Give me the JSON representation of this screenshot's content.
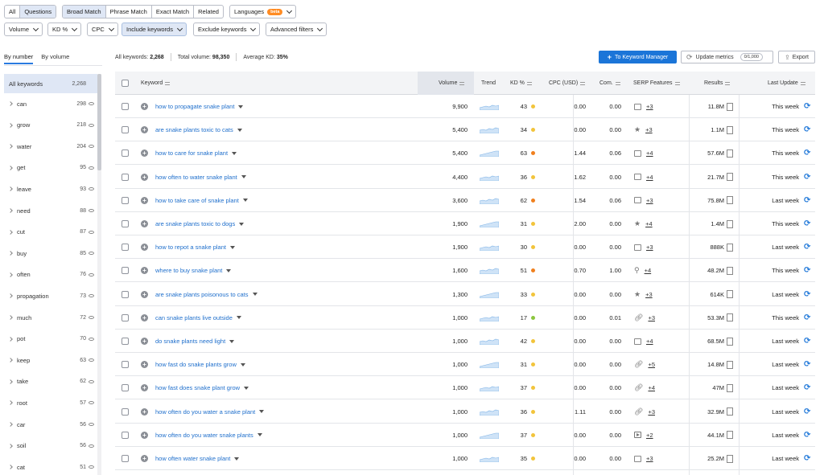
{
  "filters_row1": {
    "tabs": [
      "All",
      "Questions"
    ],
    "active_tab": "Questions",
    "match": [
      "Broad Match",
      "Phrase Match",
      "Exact Match",
      "Related"
    ],
    "active_match": "Broad Match",
    "languages": "Languages",
    "beta": "beta"
  },
  "filters_row2": {
    "volume": "Volume",
    "kd": "KD %",
    "cpc": "CPC",
    "include": "Include keywords",
    "exclude": "Exclude keywords",
    "advanced": "Advanced filters"
  },
  "sidebar": {
    "tab_number": "By number",
    "tab_volume": "By volume",
    "all_label": "All keywords",
    "all_count": "2,268",
    "items": [
      {
        "label": "can",
        "count": "298"
      },
      {
        "label": "grow",
        "count": "218"
      },
      {
        "label": "water",
        "count": "204"
      },
      {
        "label": "get",
        "count": "95"
      },
      {
        "label": "leave",
        "count": "93"
      },
      {
        "label": "need",
        "count": "88"
      },
      {
        "label": "cut",
        "count": "87"
      },
      {
        "label": "buy",
        "count": "85"
      },
      {
        "label": "often",
        "count": "76"
      },
      {
        "label": "propagation",
        "count": "73"
      },
      {
        "label": "much",
        "count": "72"
      },
      {
        "label": "pot",
        "count": "70"
      },
      {
        "label": "keep",
        "count": "63"
      },
      {
        "label": "take",
        "count": "62"
      },
      {
        "label": "root",
        "count": "57"
      },
      {
        "label": "car",
        "count": "56"
      },
      {
        "label": "soil",
        "count": "56"
      },
      {
        "label": "cat",
        "count": "51"
      }
    ]
  },
  "summary": {
    "all_keywords_label": "All keywords:",
    "all_keywords": "2,268",
    "total_volume_label": "Total volume:",
    "total_volume": "98,350",
    "avg_kd_label": "Average KD:",
    "avg_kd": "35%"
  },
  "actions": {
    "to_manager": "To Keyword Manager",
    "update": "Update metrics",
    "update_count": "0/1,000",
    "export": "Export"
  },
  "columns": {
    "keyword": "Keyword",
    "volume": "Volume",
    "trend": "Trend",
    "kd": "KD %",
    "cpc": "CPC (USD)",
    "com": "Com.",
    "serp": "SERP Features",
    "results": "Results",
    "last_update": "Last Update"
  },
  "colors": {
    "kd_yellow": "#f2c43b",
    "kd_orange": "#f0801e",
    "kd_green": "#8cc63f"
  },
  "rows": [
    {
      "keyword": "how to propagate snake plant",
      "volume": "9,900",
      "kd": "43",
      "kd_color": "yellow",
      "cpc": "0.00",
      "com": "0.00",
      "serp_icon": "image-icon",
      "serp_more": "+3",
      "results": "11.8M",
      "update": "This week"
    },
    {
      "keyword": "are snake plants toxic to cats",
      "volume": "5,400",
      "kd": "34",
      "kd_color": "yellow",
      "cpc": "0.00",
      "com": "0.00",
      "serp_icon": "star-icon",
      "serp_more": "+3",
      "results": "1.1M",
      "update": "This week"
    },
    {
      "keyword": "how to care for snake plant",
      "volume": "5,400",
      "kd": "63",
      "kd_color": "orange",
      "cpc": "1.44",
      "com": "0.06",
      "serp_icon": "image-icon",
      "serp_more": "+4",
      "results": "57.6M",
      "update": "This week"
    },
    {
      "keyword": "how often to water snake plant",
      "volume": "4,400",
      "kd": "36",
      "kd_color": "yellow",
      "cpc": "1.62",
      "com": "0.00",
      "serp_icon": "image-icon",
      "serp_more": "+4",
      "results": "21.7M",
      "update": "This week"
    },
    {
      "keyword": "how to take care of snake plant",
      "volume": "3,600",
      "kd": "62",
      "kd_color": "orange",
      "cpc": "1.54",
      "com": "0.06",
      "serp_icon": "image-icon",
      "serp_more": "+3",
      "results": "75.8M",
      "update": "Last week"
    },
    {
      "keyword": "are snake plants toxic to dogs",
      "volume": "1,900",
      "kd": "31",
      "kd_color": "yellow",
      "cpc": "2.00",
      "com": "0.00",
      "serp_icon": "star-icon",
      "serp_more": "+4",
      "results": "1.4M",
      "update": "This week"
    },
    {
      "keyword": "how to repot a snake plant",
      "volume": "1,900",
      "kd": "30",
      "kd_color": "yellow",
      "cpc": "0.00",
      "com": "0.00",
      "serp_icon": "image-icon",
      "serp_more": "+3",
      "results": "888K",
      "update": "Last week"
    },
    {
      "keyword": "where to buy snake plant",
      "volume": "1,600",
      "kd": "51",
      "kd_color": "orange",
      "cpc": "0.70",
      "com": "1.00",
      "serp_icon": "pin-icon",
      "serp_more": "+4",
      "results": "48.2M",
      "update": "This week"
    },
    {
      "keyword": "are snake plants poisonous to cats",
      "volume": "1,300",
      "kd": "33",
      "kd_color": "yellow",
      "cpc": "0.00",
      "com": "0.00",
      "serp_icon": "star-icon",
      "serp_more": "+3",
      "results": "614K",
      "update": "Last week"
    },
    {
      "keyword": "can snake plants live outside",
      "volume": "1,000",
      "kd": "17",
      "kd_color": "green",
      "cpc": "0.00",
      "com": "0.01",
      "serp_icon": "link-icon",
      "serp_more": "+3",
      "results": "53.3M",
      "update": "This week"
    },
    {
      "keyword": "do snake plants need light",
      "volume": "1,000",
      "kd": "42",
      "kd_color": "yellow",
      "cpc": "0.00",
      "com": "0.00",
      "serp_icon": "image-icon",
      "serp_more": "+4",
      "results": "68.5M",
      "update": "Last week"
    },
    {
      "keyword": "how fast do snake plants grow",
      "volume": "1,000",
      "kd": "31",
      "kd_color": "yellow",
      "cpc": "0.00",
      "com": "0.00",
      "serp_icon": "link-icon",
      "serp_more": "+5",
      "results": "14.8M",
      "update": "Last week"
    },
    {
      "keyword": "how fast does snake plant grow",
      "volume": "1,000",
      "kd": "37",
      "kd_color": "yellow",
      "cpc": "0.00",
      "com": "0.00",
      "serp_icon": "link-icon",
      "serp_more": "+4",
      "results": "47M",
      "update": "Last week"
    },
    {
      "keyword": "how often do you water a snake plant",
      "volume": "1,000",
      "kd": "36",
      "kd_color": "yellow",
      "cpc": "1.11",
      "com": "0.00",
      "serp_icon": "link-icon",
      "serp_more": "+3",
      "results": "32.9M",
      "update": "Last week"
    },
    {
      "keyword": "how often do you water snake plants",
      "volume": "1,000",
      "kd": "37",
      "kd_color": "yellow",
      "cpc": "0.00",
      "com": "0.00",
      "serp_icon": "video-icon",
      "serp_more": "+2",
      "results": "44.1M",
      "update": "Last week"
    },
    {
      "keyword": "how often water snake plant",
      "volume": "1,000",
      "kd": "35",
      "kd_color": "yellow",
      "cpc": "0.00",
      "com": "0.00",
      "serp_icon": "image-icon",
      "serp_more": "+3",
      "results": "25.2M",
      "update": "Last week"
    }
  ]
}
